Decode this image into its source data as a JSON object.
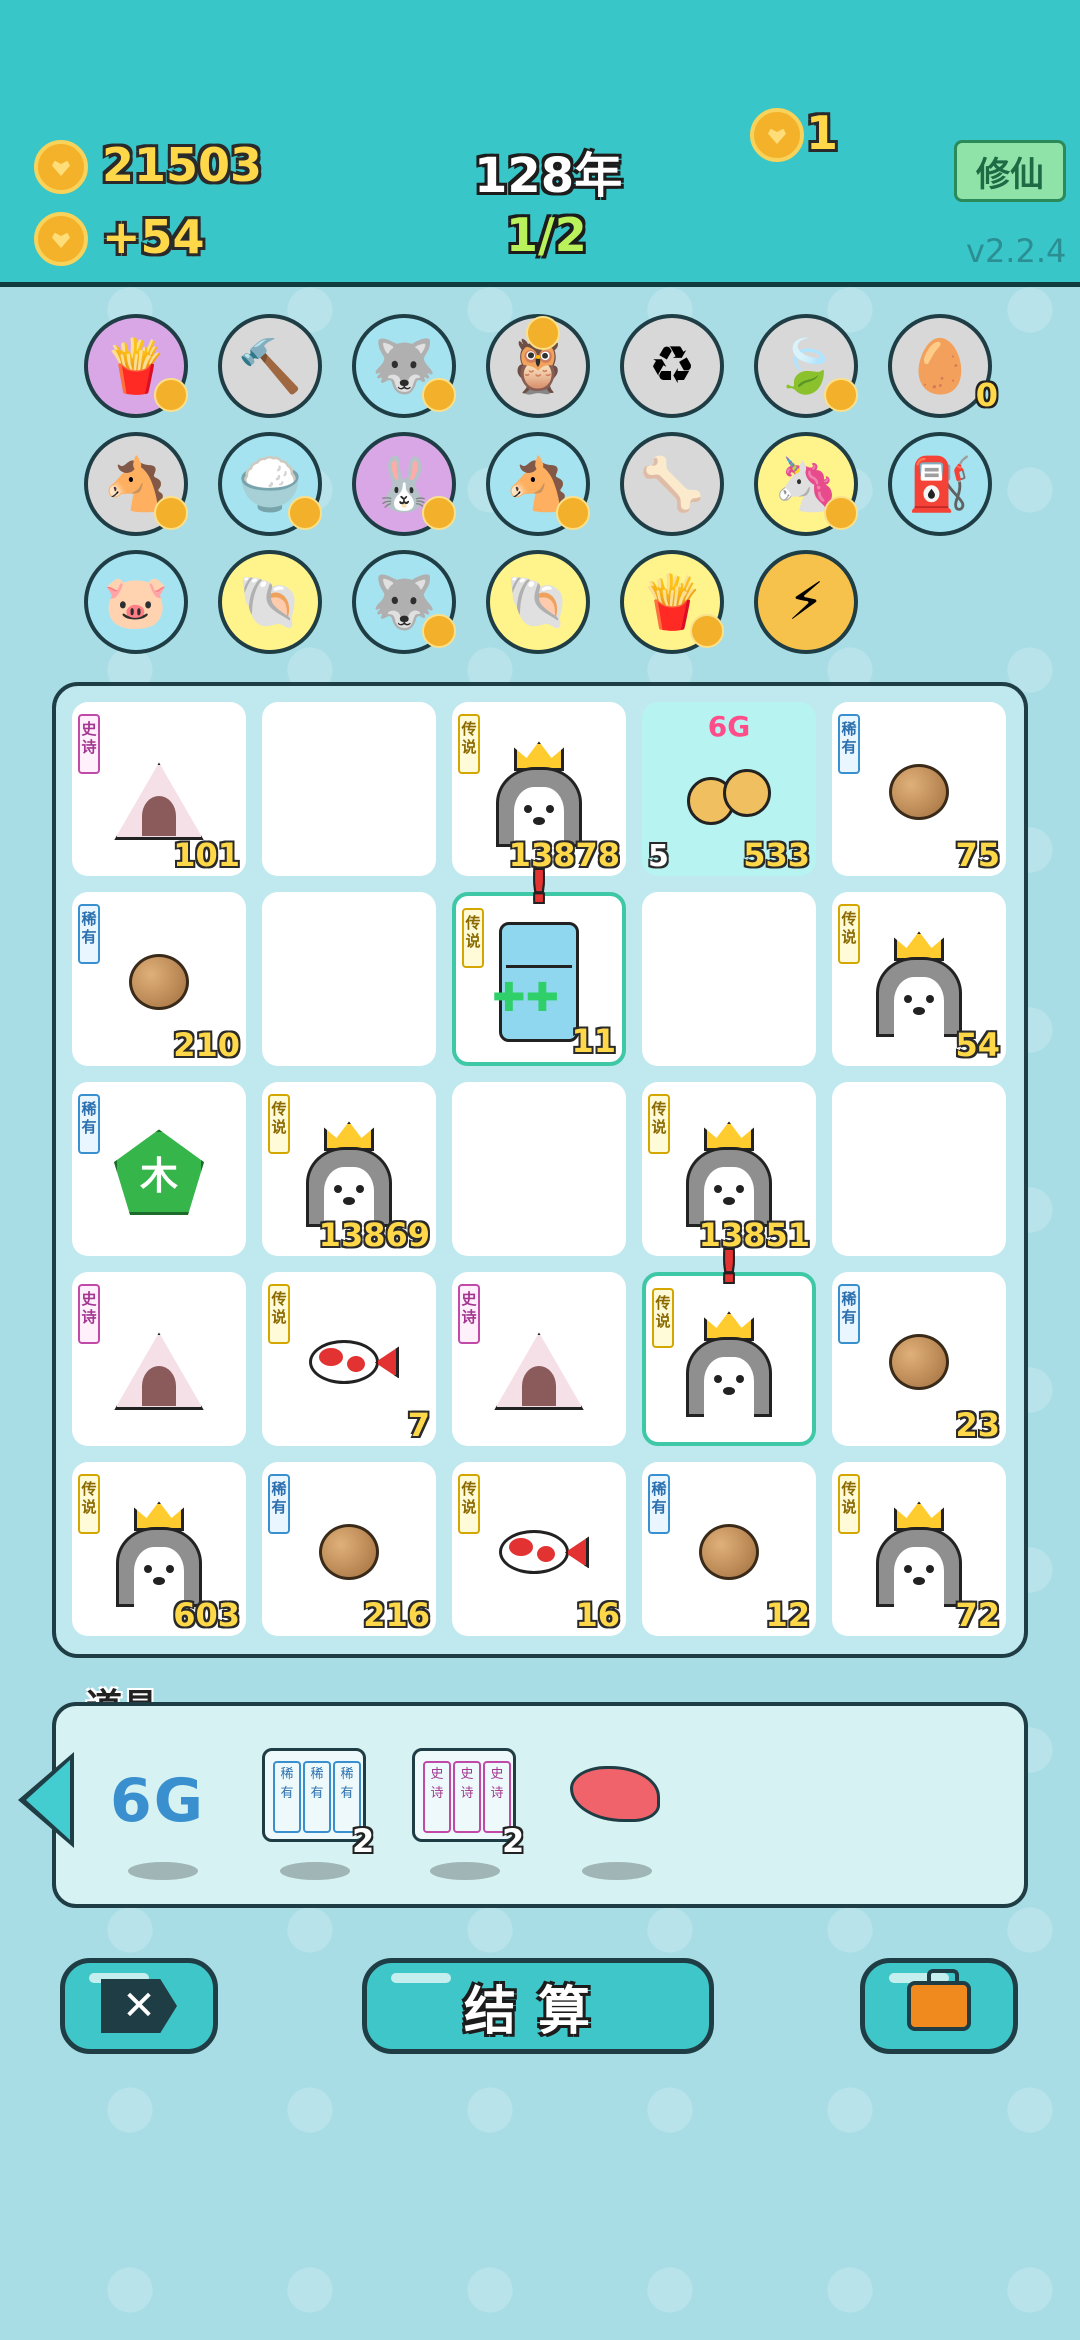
{
  "header": {
    "gold": "21503",
    "gold_rate": "+54",
    "year": "128年",
    "round": "1/2",
    "ticket": "1",
    "cultivate_label": "修仙",
    "version": "v2.2.4"
  },
  "collection": {
    "row1": [
      "fries-icon",
      "hammer-icon",
      "husky-icon",
      "owls-icon",
      "trash-bag-icon",
      "leaf-icon",
      "egg-tray-icon"
    ],
    "row2": [
      "horses-icon",
      "rice-bowl-icon",
      "rabbit-icon",
      "horses-icon",
      "dog-food-icon",
      "unicorn-icon",
      "pump-icon"
    ],
    "row3": [
      "piggy-bank-icon",
      "shell-icon",
      "husky-icon",
      "shell-icon",
      "fries-icon",
      "lightning-icon"
    ],
    "egg_tray_count": "0"
  },
  "board": {
    "cells": [
      {
        "tag": "史诗",
        "type": "tent",
        "value": "101"
      },
      {
        "type": "empty"
      },
      {
        "tag": "传说",
        "type": "husky",
        "value": "13878"
      },
      {
        "type": "cherries",
        "label": "6G",
        "left": "5",
        "value": "533"
      },
      {
        "tag": "稀有",
        "type": "nut",
        "value": "75"
      },
      {
        "tag": "稀有",
        "type": "nut",
        "value": "210"
      },
      {
        "type": "empty"
      },
      {
        "tag": "传说",
        "type": "fridge",
        "value": "11"
      },
      {
        "type": "empty"
      },
      {
        "tag": "传说",
        "type": "husky",
        "value": "54"
      },
      {
        "tag": "稀有",
        "type": "wood",
        "value": "",
        "glyph": "木"
      },
      {
        "tag": "传说",
        "type": "husky",
        "value": "13869"
      },
      {
        "type": "empty"
      },
      {
        "tag": "传说",
        "type": "husky",
        "value": "13851"
      },
      {
        "type": "empty"
      },
      {
        "tag": "史诗",
        "type": "tent",
        "value": ""
      },
      {
        "tag": "传说",
        "type": "koi",
        "value": "7"
      },
      {
        "tag": "史诗",
        "type": "tent",
        "value": ""
      },
      {
        "tag": "传说",
        "type": "husky",
        "value": ""
      },
      {
        "tag": "稀有",
        "type": "nut",
        "value": "23"
      },
      {
        "tag": "传说",
        "type": "husky",
        "value": "603"
      },
      {
        "tag": "稀有",
        "type": "nut",
        "value": "216"
      },
      {
        "tag": "传说",
        "type": "koi",
        "value": "16"
      },
      {
        "tag": "稀有",
        "type": "nut",
        "value": "12"
      },
      {
        "tag": "传说",
        "type": "husky",
        "value": "72"
      }
    ]
  },
  "tools": {
    "label": "道具",
    "items": [
      {
        "name": "6G",
        "count": ""
      },
      {
        "name": "rare-reroll-icon",
        "count": "2"
      },
      {
        "name": "epic-reroll-icon",
        "count": "2"
      },
      {
        "name": "liver-icon",
        "count": ""
      }
    ],
    "rare_tag": "稀有",
    "epic_tag": "史诗"
  },
  "buttons": {
    "settle_label": "结算"
  },
  "colors": {
    "accent": "#39c6c8",
    "board_bg": "#bfe9ee",
    "outline": "#1f3d44",
    "gold": "#ffd84a"
  }
}
